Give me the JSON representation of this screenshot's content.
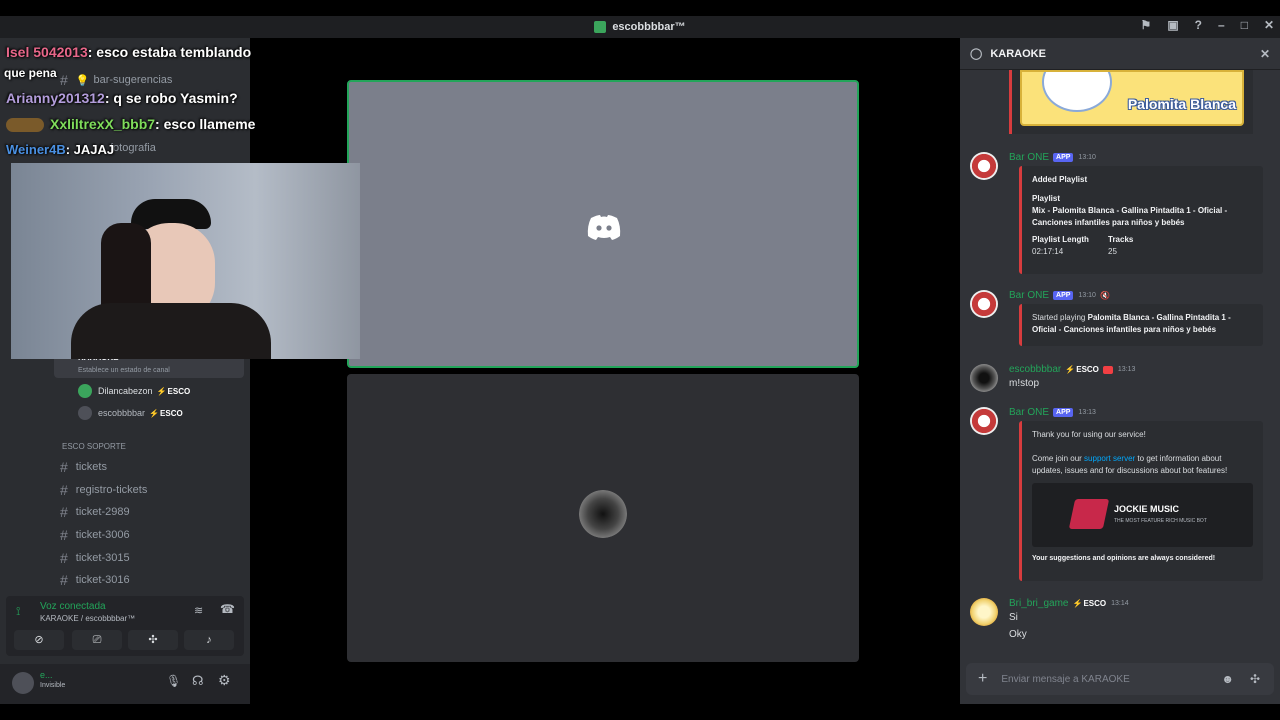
{
  "window": {
    "title": "escobbbbar™"
  },
  "sidebar": {
    "channels": [
      {
        "label": "bar-sugerencias",
        "emoji": "💡"
      },
      {
        "label": "fotografia"
      },
      {
        "label": "tickets"
      },
      {
        "label": "registro-tickets"
      },
      {
        "label": "ticket-2989"
      },
      {
        "label": "ticket-3006"
      },
      {
        "label": "ticket-3015"
      },
      {
        "label": "ticket-3016"
      }
    ],
    "voice_channel": {
      "name": "KARAOKE",
      "status_placeholder": "Establece un estado de canal"
    },
    "voice_users": [
      {
        "name": "Dilancabezon",
        "tag": "ESCO"
      },
      {
        "name": "escobbbbar",
        "tag": "ESCO"
      }
    ],
    "category": "ESCO SOPORTE",
    "voice_panel": {
      "status": "Voz conectada",
      "location": "KARAOKE / escobbbbar™"
    },
    "user": {
      "name": "e...",
      "status": "Invisible"
    }
  },
  "overlay_chat": [
    {
      "user": "Isel 5042013",
      "text": ": esco estaba temblando",
      "color": "#e8678a"
    },
    {
      "user": "",
      "text": "que pena",
      "color": "#ffffff"
    },
    {
      "user": "Arianny201312",
      "text": ": q se robo Yasmin?",
      "color": "#b39ddb"
    },
    {
      "user": "XxliltrexX_bbb7",
      "text": ": esco llameme",
      "color": "#7fdc5b"
    },
    {
      "user": "Weiner4B",
      "text": ": JAJAJ",
      "color": "#4a90e2"
    }
  ],
  "chat": {
    "channel": "KARAOKE",
    "embed_image_text": "Palomita Blanca",
    "messages": [
      {
        "author": "Bar ONE",
        "tag": "APP",
        "time": "13:10",
        "embed": {
          "title": "Added Playlist",
          "playlist_label": "Playlist",
          "playlist_value": "Mix - Palomita Blanca - Gallina Pintadita 1 - Oficial - Canciones infantiles para niños y bebés",
          "length_label": "Playlist Length",
          "length_value": "02:17:14",
          "tracks_label": "Tracks",
          "tracks_value": "25"
        }
      },
      {
        "author": "Bar ONE",
        "tag": "APP",
        "time": "13:10",
        "embed": {
          "prefix": "Started playing",
          "song": "Palomita Blanca - Gallina Pintadita 1 - Oficial - Canciones infantiles para niños y bebés"
        }
      },
      {
        "author": "escobbbbar",
        "tag": "ESCO",
        "time": "13:13",
        "text": "m!stop"
      },
      {
        "author": "Bar ONE",
        "tag": "APP",
        "time": "13:13",
        "embed": {
          "thanks": "Thank you for using our service!",
          "join_prefix": "Come join our",
          "join_link": "support server",
          "join_suffix": "to get information about updates, issues and for discussions about bot features!",
          "brand": "JOCKIE MUSIC",
          "brand_sub": "THE MOST FEATURE RICH MUSIC BOT",
          "footer": "Your suggestions and opinions are always considered!"
        }
      },
      {
        "author": "Bri_bri_game",
        "tag": "ESCO",
        "time": "13:14",
        "lines": [
          "Si",
          "Oky"
        ]
      }
    ],
    "input_placeholder": "Enviar mensaje a KARAOKE"
  }
}
